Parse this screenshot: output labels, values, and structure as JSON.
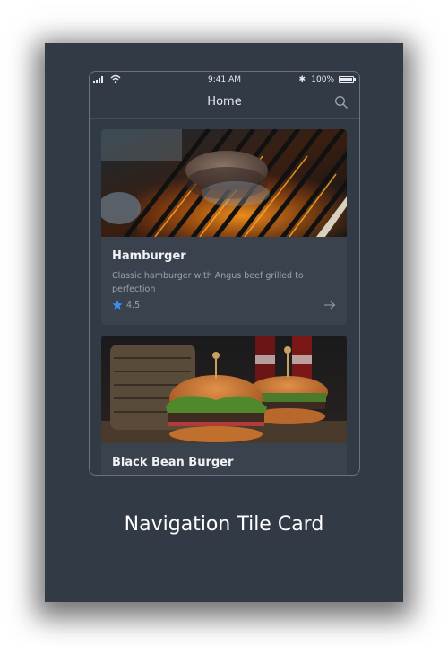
{
  "status_bar": {
    "time": "9:41 AM",
    "bluetooth": "✱",
    "battery": "100%"
  },
  "nav": {
    "title": "Home",
    "search_icon": "search-icon"
  },
  "cards": [
    {
      "title": "Hamburger",
      "description": "Classic hamburger with Angus beef grilled to perfection",
      "rating": "4.5",
      "rating_icon": "star-icon",
      "action_icon": "arrow-right-icon",
      "image": "grilled-patty-photo"
    },
    {
      "title": "Black Bean Burger",
      "image": "burger-photo"
    }
  ],
  "caption": "Navigation Tile Card",
  "colors": {
    "background": "#323a45",
    "card": "#3a424e",
    "star": "#3d8ef0",
    "text": "#f0f2f5",
    "muted": "#9aa2ad"
  }
}
